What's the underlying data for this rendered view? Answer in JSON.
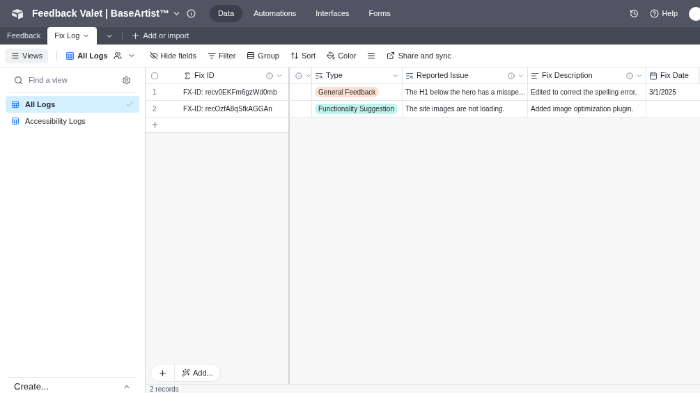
{
  "app": {
    "base_name": "Feedback Valet | BaseArtist™",
    "nav": [
      {
        "label": "Data",
        "selected": true
      },
      {
        "label": "Automations",
        "selected": false
      },
      {
        "label": "Interfaces",
        "selected": false
      },
      {
        "label": "Forms",
        "selected": false
      }
    ],
    "help": "Help"
  },
  "tables": [
    {
      "label": "Feedback",
      "selected": false
    },
    {
      "label": "Fix Log",
      "selected": true
    }
  ],
  "add_or_import": "Add or import",
  "toolbar": {
    "views": "Views",
    "current_view": "All Logs",
    "actions": [
      "Hide fields",
      "Filter",
      "Group",
      "Sort",
      "Color"
    ],
    "share": "Share and sync"
  },
  "sidebar": {
    "search_placeholder": "Find a view",
    "views": [
      {
        "label": "All Logs",
        "selected": true
      },
      {
        "label": "Accessibility Logs",
        "selected": false
      }
    ],
    "create": "Create..."
  },
  "table": {
    "select_all_checked": false,
    "columns": [
      "Fix ID",
      "Type",
      "Reported Issue",
      "Fix Description",
      "Fix Date"
    ],
    "rows": [
      {
        "number": "1",
        "fix_id": "FX-ID: recv0EKFm6gzWd0mb",
        "type": {
          "label": "General Feedback",
          "color": "#fde0cf"
        },
        "issue": "The H1 below the hero has a misspe…",
        "fix": "Edited to correct the spelling error.",
        "date": "3/1/2025"
      },
      {
        "number": "2",
        "fix_id": "FX-ID: recOzfA8qSfkAGGAn",
        "type": {
          "label": "Functionality Suggestion",
          "color": "#c2f3ee"
        },
        "issue": "The site images are not loading.",
        "fix": "Added image optimization plugin.",
        "date": ""
      }
    ]
  },
  "add_button": "Add...",
  "status": "2 records"
}
